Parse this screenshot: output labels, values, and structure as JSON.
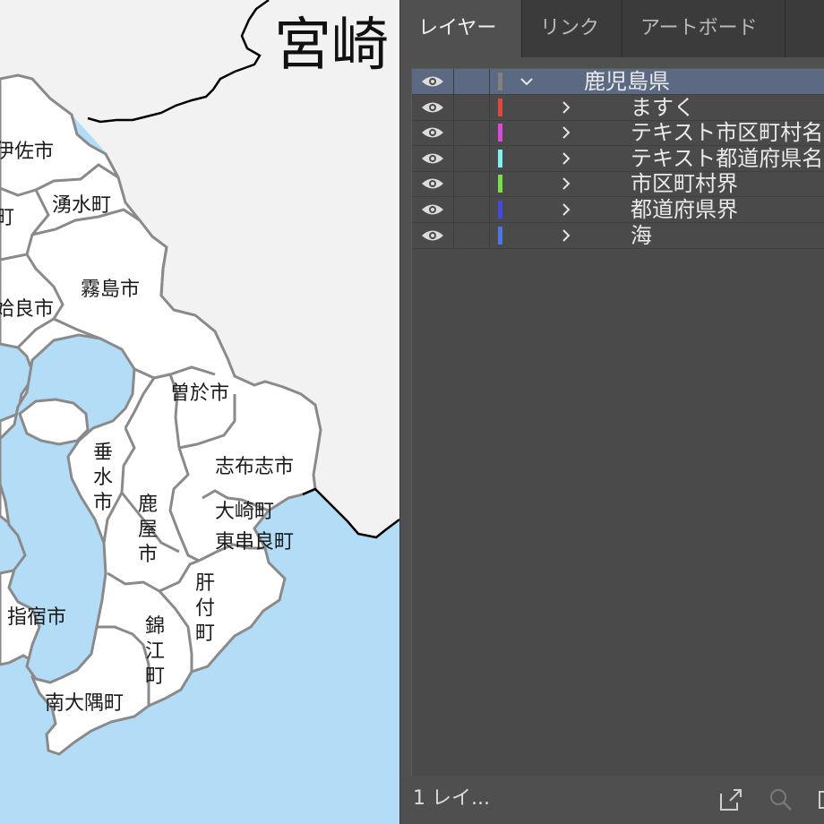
{
  "map": {
    "title": "宮崎",
    "labels": [
      {
        "id": "isa",
        "text": "伊佐市"
      },
      {
        "id": "yusui",
        "text": "湧水町"
      },
      {
        "id": "aira-frag",
        "text": "町"
      },
      {
        "id": "kirishima",
        "text": "霧島市"
      },
      {
        "id": "aira",
        "text": "姶良市"
      },
      {
        "id": "soo",
        "text": "曽於市"
      },
      {
        "id": "tarumizu",
        "text": "垂水市"
      },
      {
        "id": "shibushi",
        "text": "志布志市"
      },
      {
        "id": "kanoya",
        "text": "鹿屋市"
      },
      {
        "id": "osaki",
        "text": "大崎町"
      },
      {
        "id": "higashikushira",
        "text": "東串良町"
      },
      {
        "id": "kimotsuki",
        "text": "肝付町"
      },
      {
        "id": "ibusuki",
        "text": "指宿市"
      },
      {
        "id": "kinko",
        "text": "錦江町"
      },
      {
        "id": "minamiosumi",
        "text": "南大隅町"
      }
    ],
    "colors": {
      "land": "#ffffff",
      "sea": "#b3dcf7",
      "other_prefecture": "#f2f2f2",
      "border": "#8a8a8a",
      "prefecture_border": "#000000"
    }
  },
  "panel": {
    "tabs": [
      {
        "id": "layers",
        "label": "レイヤー",
        "active": true
      },
      {
        "id": "links",
        "label": "リンク",
        "active": false
      },
      {
        "id": "artboards",
        "label": "アートボード",
        "active": false
      }
    ],
    "layers": [
      {
        "name": "鹿児島県",
        "color": "#808080",
        "expanded": true,
        "selected": true,
        "depth": 0
      },
      {
        "name": "ますく",
        "color": "#e0483c",
        "expanded": false,
        "selected": false,
        "depth": 1
      },
      {
        "name": "テキスト市区町村名",
        "color": "#d94adf",
        "expanded": false,
        "selected": false,
        "depth": 1
      },
      {
        "name": "テキスト都道府県名",
        "color": "#7ff3f0",
        "expanded": false,
        "selected": false,
        "depth": 1
      },
      {
        "name": "市区町村界",
        "color": "#77e04f",
        "expanded": false,
        "selected": false,
        "depth": 1
      },
      {
        "name": "都道府県界",
        "color": "#4646e0",
        "expanded": false,
        "selected": false,
        "depth": 1
      },
      {
        "name": "海",
        "color": "#4d74e8",
        "expanded": false,
        "selected": false,
        "depth": 1
      }
    ],
    "footer": {
      "layer_count": "1 レイ..."
    },
    "icons": {
      "visibility": "eye-icon",
      "expand": "chevron-right-icon",
      "collapse": "chevron-down-icon",
      "export": "export-icon",
      "search": "search-icon"
    }
  }
}
